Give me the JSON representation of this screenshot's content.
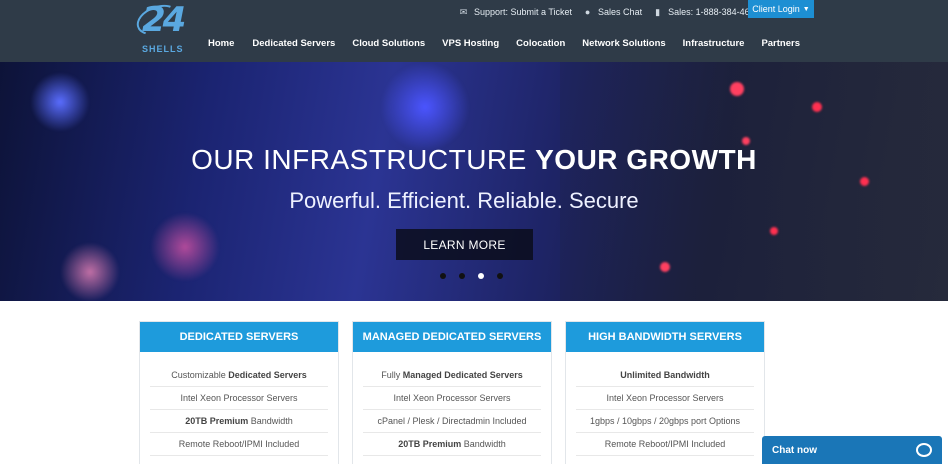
{
  "logo": {
    "number": "24",
    "word": "SHELLS"
  },
  "topbar": {
    "support": "Support: Submit a Ticket",
    "chat": "Sales Chat",
    "phone": "Sales: 1-888-384-4678",
    "client_login": "Client Login"
  },
  "nav": [
    "Home",
    "Dedicated Servers",
    "Cloud Solutions",
    "VPS Hosting",
    "Colocation",
    "Network Solutions",
    "Infrastructure",
    "Partners"
  ],
  "hero": {
    "title_thin": "OUR INFRASTRUCTURE ",
    "title_bold": "YOUR GROWTH",
    "subtitle": "Powerful. Efficient. Reliable. Secure",
    "button": "LEARN MORE",
    "slides": 4,
    "active_slide": 3
  },
  "cards": [
    {
      "title": "DEDICATED SERVERS",
      "rows": [
        {
          "pre": "Customizable ",
          "bold": "Dedicated Servers",
          "post": ""
        },
        {
          "pre": "Intel Xeon Processor Servers",
          "bold": "",
          "post": ""
        },
        {
          "pre": "",
          "bold": "20TB Premium",
          "post": " Bandwidth"
        },
        {
          "pre": "Remote Reboot/IPMI Included",
          "bold": "",
          "post": ""
        }
      ]
    },
    {
      "title": "MANAGED DEDICATED SERVERS",
      "rows": [
        {
          "pre": "Fully ",
          "bold": "Managed Dedicated Servers",
          "post": ""
        },
        {
          "pre": "Intel Xeon Processor Servers",
          "bold": "",
          "post": ""
        },
        {
          "pre": "cPanel / Plesk / Directadmin Included",
          "bold": "",
          "post": ""
        },
        {
          "pre": "",
          "bold": "20TB Premium",
          "post": " Bandwidth"
        }
      ]
    },
    {
      "title": "HIGH BANDWIDTH SERVERS",
      "rows": [
        {
          "pre": "",
          "bold": "Unlimited Bandwidth",
          "post": ""
        },
        {
          "pre": "Intel Xeon Processor Servers",
          "bold": "",
          "post": ""
        },
        {
          "pre": "1gbps / 10gbps / 20gbps port Options",
          "bold": "",
          "post": ""
        },
        {
          "pre": "Remote Reboot/IPMI Included",
          "bold": "",
          "post": ""
        }
      ]
    }
  ],
  "chat": {
    "label": "Chat now"
  },
  "colors": {
    "header": "#2f3b48",
    "accent": "#1e9bdc",
    "chat": "#1a76b7"
  }
}
